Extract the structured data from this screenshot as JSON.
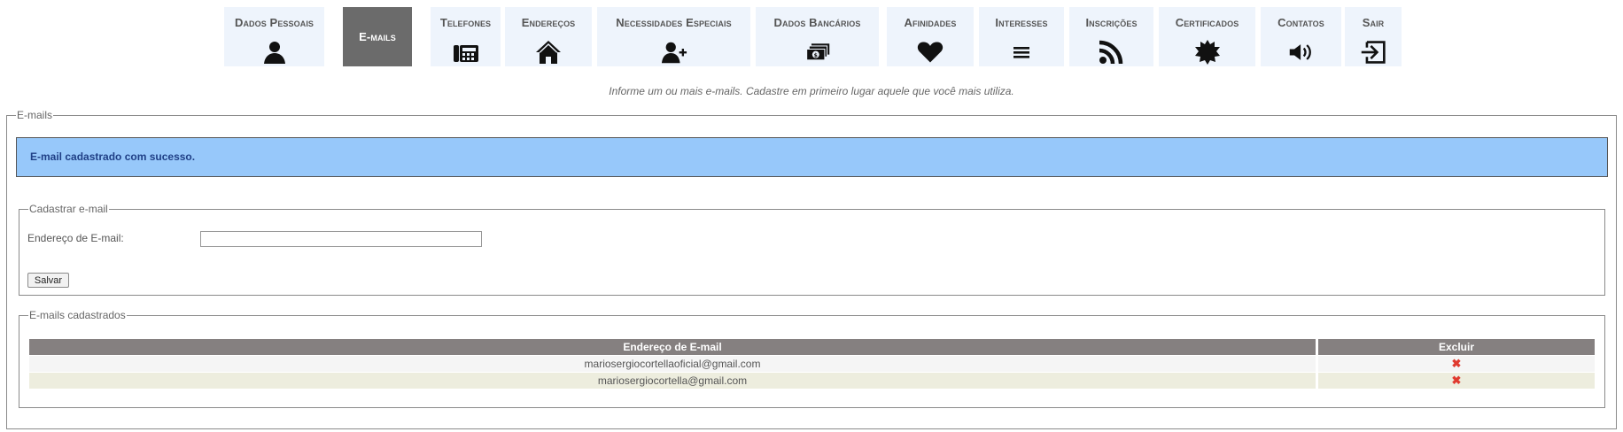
{
  "menu": {
    "tabs": [
      {
        "id": "dados-pessoais",
        "label": "Dados Pessoais",
        "icon": "person-icon"
      },
      {
        "id": "emails",
        "label": "E-mails",
        "icon": "",
        "active": true
      },
      {
        "id": "telefones",
        "label": "Telefones",
        "icon": "phone-icon"
      },
      {
        "id": "enderecos",
        "label": "Endereços",
        "icon": "home-icon"
      },
      {
        "id": "necessidades-especiais",
        "label": "Necessidades Especiais",
        "icon": "user-plus-icon"
      },
      {
        "id": "dados-bancarios",
        "label": "Dados Bancários",
        "icon": "money-icon"
      },
      {
        "id": "afinidades",
        "label": "Afinidades",
        "icon": "heart-icon"
      },
      {
        "id": "interesses",
        "label": "Interesses",
        "icon": "list-icon"
      },
      {
        "id": "inscricoes",
        "label": "Inscrições",
        "icon": "rss-icon"
      },
      {
        "id": "certificados",
        "label": "Certificados",
        "icon": "badge-icon"
      },
      {
        "id": "contatos",
        "label": "Contatos",
        "icon": "speaker-icon"
      },
      {
        "id": "sair",
        "label": "Sair",
        "icon": "exit-icon"
      }
    ]
  },
  "hint": "Informe um ou mais e-mails. Cadastre em primeiro lugar aquele que você mais utiliza.",
  "emails_section": {
    "legend": "E-mails",
    "alert": "E-mail cadastrado com sucesso."
  },
  "register": {
    "legend": "Cadastrar e-mail",
    "field_label": "Endereço de E-mail:",
    "field_value": "",
    "save_label": "Salvar"
  },
  "registered": {
    "legend": "E-mails cadastrados",
    "columns": [
      "Endereço de E-mail",
      "Excluir"
    ],
    "rows": [
      {
        "email": "mariosergiocortellaoficial@gmail.com",
        "delete": "✖"
      },
      {
        "email": "mariosergiocortella@gmail.com",
        "delete": "✖"
      }
    ]
  },
  "colors": {
    "tab_bg": "#eef4fc",
    "tab_active_bg": "#6b6b6b",
    "alert_bg": "#97c8fa",
    "alert_text": "#1f3f86",
    "table_header_bg": "#858080",
    "delete_icon": "#e03a2f"
  }
}
